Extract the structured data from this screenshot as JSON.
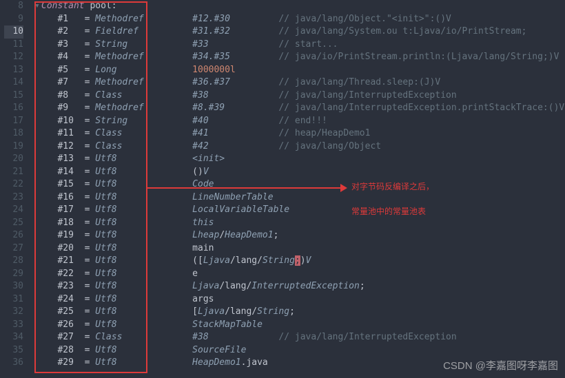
{
  "gutter": {
    "start": 8,
    "end": 36,
    "active": 10
  },
  "header": "Constant pool:",
  "lines": [
    {
      "idx": "#1",
      "eq": "=",
      "kind": "Methodref",
      "c2": "#12.#30",
      "cm": "// java/lang/Object.\"<init>\":()V"
    },
    {
      "idx": "#2",
      "eq": "=",
      "kind": "Fieldref",
      "c2": "#31.#32",
      "cm": "// java/lang/System.ou t:Ljava/io/PrintStream;"
    },
    {
      "idx": "#3",
      "eq": "=",
      "kind": "String",
      "c2": "#33",
      "cm": "// start..."
    },
    {
      "idx": "#4",
      "eq": "=",
      "kind": "Methodref",
      "c2": "#34.#35",
      "cm": "// java/io/PrintStream.println:(Ljava/lang/String;)V"
    },
    {
      "idx": "#5",
      "eq": "=",
      "kind": "Long",
      "c2": "1000000l",
      "cm": "",
      "numlit": true
    },
    {
      "idx": "#7",
      "eq": "=",
      "kind": "Methodref",
      "c2": "#36.#37",
      "cm": "// java/lang/Thread.sleep:(J)V"
    },
    {
      "idx": "#8",
      "eq": "=",
      "kind": "Class",
      "c2": "#38",
      "cm": "// java/lang/InterruptedException"
    },
    {
      "idx": "#9",
      "eq": "=",
      "kind": "Methodref",
      "c2": "#8.#39",
      "cm": "// java/lang/InterruptedException.printStackTrace:()V"
    },
    {
      "idx": "#10",
      "eq": "=",
      "kind": "String",
      "c2": "#40",
      "cm": "// end!!!"
    },
    {
      "idx": "#11",
      "eq": "=",
      "kind": "Class",
      "c2": "#41",
      "cm": "// heap/HeapDemo1"
    },
    {
      "idx": "#12",
      "eq": "=",
      "kind": "Class",
      "c2": "#42",
      "cm": "// java/lang/Object"
    },
    {
      "idx": "#13",
      "eq": "=",
      "kind": "Utf8",
      "c2": "<init>",
      "cm": ""
    },
    {
      "idx": "#14",
      "eq": "=",
      "kind": "Utf8",
      "c2": "()V",
      "cm": "",
      "mixed": [
        {
          "t": "()",
          "c": "white"
        },
        {
          "t": "V",
          "c": "type"
        }
      ]
    },
    {
      "idx": "#15",
      "eq": "=",
      "kind": "Utf8",
      "c2": "Code",
      "cm": ""
    },
    {
      "idx": "#16",
      "eq": "=",
      "kind": "Utf8",
      "c2": "LineNumberTable",
      "cm": ""
    },
    {
      "idx": "#17",
      "eq": "=",
      "kind": "Utf8",
      "c2": "LocalVariableTable",
      "cm": ""
    },
    {
      "idx": "#18",
      "eq": "=",
      "kind": "Utf8",
      "c2": "this",
      "cm": ""
    },
    {
      "idx": "#19",
      "eq": "=",
      "kind": "Utf8",
      "c2": "Lheap/HeapDemo1;",
      "cm": "",
      "mixed": [
        {
          "t": "Lheap",
          "c": "type"
        },
        {
          "t": "/",
          "c": "white"
        },
        {
          "t": "HeapDemo1",
          "c": "type"
        },
        {
          "t": ";",
          "c": "white"
        }
      ]
    },
    {
      "idx": "#20",
      "eq": "=",
      "kind": "Utf8",
      "c2": "main",
      "cm": "",
      "plain": true
    },
    {
      "idx": "#21",
      "eq": "=",
      "kind": "Utf8",
      "c2": "([Ljava/lang/String;)V",
      "cm": "",
      "mixed": [
        {
          "t": "([",
          "c": "white"
        },
        {
          "t": "Ljava",
          "c": "type"
        },
        {
          "t": "/",
          "c": "white"
        },
        {
          "t": "lang",
          "c": "white"
        },
        {
          "t": "/",
          "c": "white"
        },
        {
          "t": "String",
          "c": "type"
        },
        {
          "t": ";",
          "c": "hl-cursor"
        },
        {
          "t": ")",
          "c": "white"
        },
        {
          "t": "V",
          "c": "type"
        }
      ]
    },
    {
      "idx": "#22",
      "eq": "=",
      "kind": "Utf8",
      "c2": "e",
      "cm": "",
      "plain": true
    },
    {
      "idx": "#23",
      "eq": "=",
      "kind": "Utf8",
      "c2": "Ljava/lang/InterruptedException;",
      "cm": "",
      "mixed": [
        {
          "t": "Ljava",
          "c": "type"
        },
        {
          "t": "/",
          "c": "white"
        },
        {
          "t": "lang",
          "c": "white"
        },
        {
          "t": "/",
          "c": "white"
        },
        {
          "t": "InterruptedException",
          "c": "type"
        },
        {
          "t": ";",
          "c": "white"
        }
      ]
    },
    {
      "idx": "#24",
      "eq": "=",
      "kind": "Utf8",
      "c2": "args",
      "cm": "",
      "plain": true
    },
    {
      "idx": "#25",
      "eq": "=",
      "kind": "Utf8",
      "c2": "[Ljava/lang/String;",
      "cm": "",
      "mixed": [
        {
          "t": "[",
          "c": "white"
        },
        {
          "t": "Ljava",
          "c": "type"
        },
        {
          "t": "/",
          "c": "white"
        },
        {
          "t": "lang",
          "c": "white"
        },
        {
          "t": "/",
          "c": "white"
        },
        {
          "t": "String",
          "c": "type"
        },
        {
          "t": ";",
          "c": "white"
        }
      ]
    },
    {
      "idx": "#26",
      "eq": "=",
      "kind": "Utf8",
      "c2": "StackMapTable",
      "cm": ""
    },
    {
      "idx": "#27",
      "eq": "=",
      "kind": "Class",
      "c2": "#38",
      "cm": "// java/lang/InterruptedException"
    },
    {
      "idx": "#28",
      "eq": "=",
      "kind": "Utf8",
      "c2": "SourceFile",
      "cm": ""
    },
    {
      "idx": "#29",
      "eq": "=",
      "kind": "Utf8",
      "c2": "HeapDemo1.java",
      "cm": "",
      "mixed": [
        {
          "t": "HeapDemo1",
          "c": "type"
        },
        {
          "t": ".java",
          "c": "white"
        }
      ]
    }
  ],
  "annotations": {
    "line1": "对字节码反编译之后，",
    "line2": "常量池中的常量池表"
  },
  "watermark": "CSDN @李嘉图呀李嘉图",
  "fold_icon": "▾"
}
